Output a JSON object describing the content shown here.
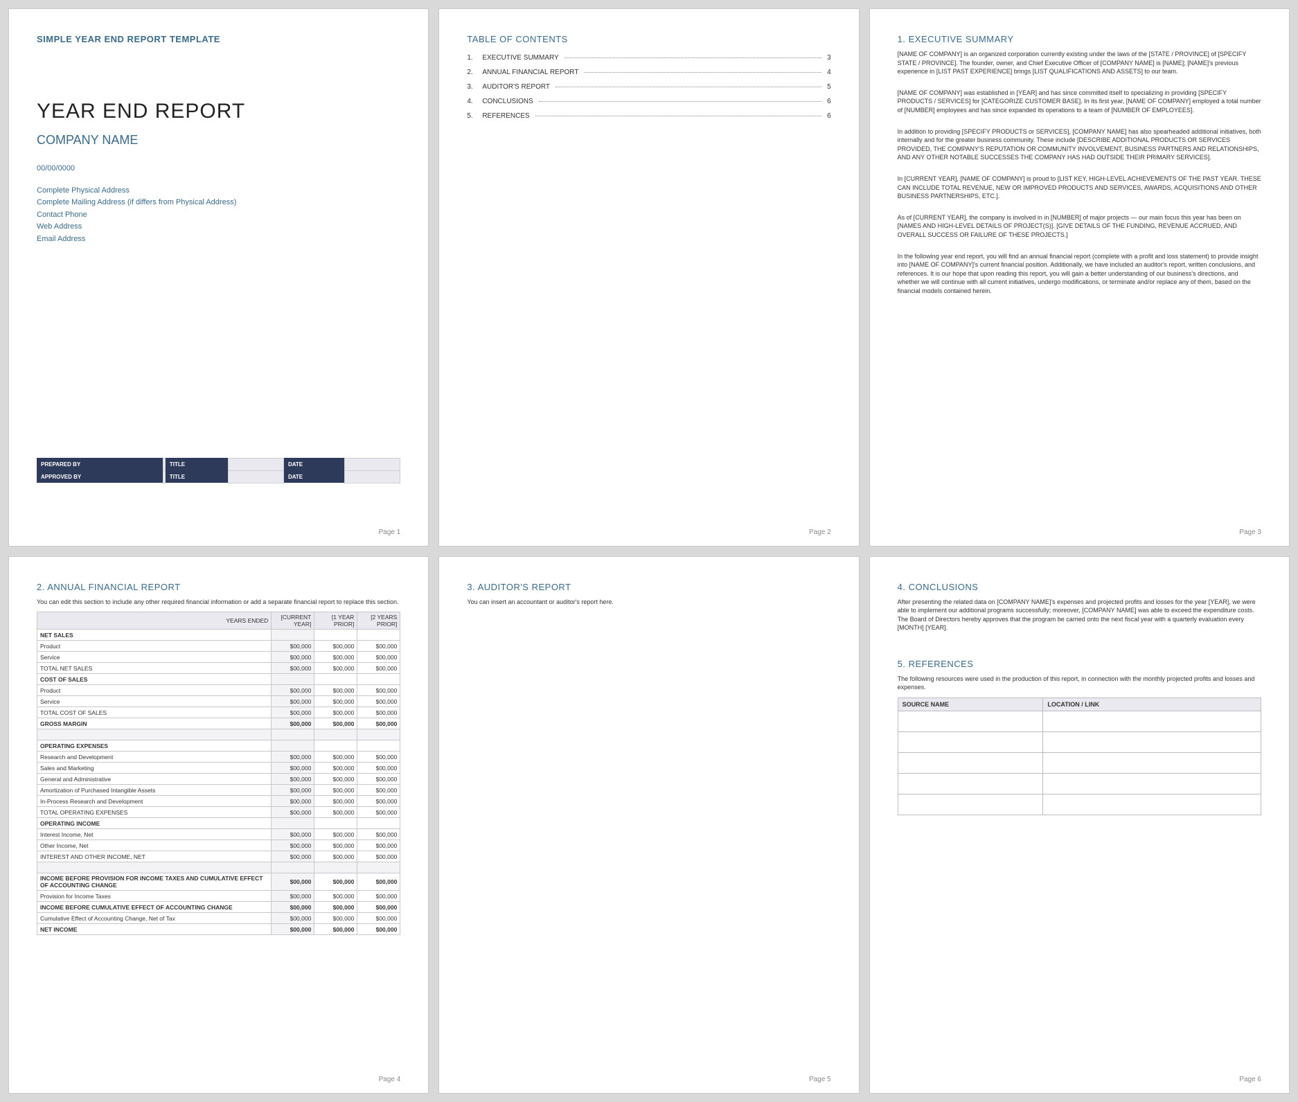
{
  "pageLabels": {
    "p1": "Page 1",
    "p2": "Page 2",
    "p3": "Page 3",
    "p4": "Page 4",
    "p5": "Page 5",
    "p6": "Page 6"
  },
  "cover": {
    "templateLabel": "SIMPLE YEAR END REPORT TEMPLATE",
    "title": "YEAR END REPORT",
    "company": "COMPANY NAME",
    "date": "00/00/0000",
    "fields": [
      "Complete Physical Address",
      "Complete Mailing Address (if differs from Physical Address)",
      "Contact Phone",
      "Web Address",
      "Email Address"
    ],
    "signRows": [
      {
        "l1": "PREPARED BY",
        "l2": "TITLE",
        "l3": "DATE"
      },
      {
        "l1": "APPROVED BY",
        "l2": "TITLE",
        "l3": "DATE"
      }
    ]
  },
  "toc": {
    "heading": "TABLE OF CONTENTS",
    "items": [
      {
        "n": "1.",
        "label": "EXECUTIVE SUMMARY",
        "pg": "3"
      },
      {
        "n": "2.",
        "label": "ANNUAL FINANCIAL REPORT",
        "pg": "4"
      },
      {
        "n": "3.",
        "label": "AUDITOR'S REPORT",
        "pg": "5"
      },
      {
        "n": "4.",
        "label": "CONCLUSIONS",
        "pg": "6"
      },
      {
        "n": "5.",
        "label": "REFERENCES",
        "pg": "6"
      }
    ]
  },
  "exec": {
    "heading": "1. EXECUTIVE SUMMARY",
    "paras": [
      "[NAME OF COMPANY] is an organized corporation currently existing under the laws of the [STATE / PROVINCE] of [SPECIFY STATE / PROVINCE]. The founder, owner, and Chief Executive Officer of [COMPANY NAME] is [NAME]; [NAME]'s previous experience in [LIST PAST EXPERIENCE] brings [LIST QUALIFICATIONS AND ASSETS] to our team.",
      "[NAME OF COMPANY] was established in [YEAR] and has since committed itself to specializing in providing [SPECIFY PRODUCTS / SERVICES] for [CATEGORIZE CUSTOMER BASE]. In its first year, [NAME OF COMPANY] employed a total number of [NUMBER] employees and has since expanded its operations to a team of [NUMBER OF EMPLOYEES].",
      "In addition to providing [SPECIFY PRODUCTS or SERVICES], [COMPANY NAME] has also spearheaded additional initiatives, both internally and for the greater business community. These include [DESCRIBE ADDITIONAL PRODUCTS OR SERVICES PROVIDED, THE COMPANY'S REPUTATION OR COMMUNITY INVOLVEMENT, BUSINESS PARTNERS AND RELATIONSHIPS, AND ANY OTHER NOTABLE SUCCESSES THE COMPANY HAS HAD OUTSIDE THEIR PRIMARY SERVICES].",
      "In [CURRENT YEAR], [NAME OF COMPANY] is proud to [LIST KEY, HIGH-LEVEL ACHIEVEMENTS OF THE PAST YEAR. THESE CAN INCLUDE TOTAL REVENUE, NEW OR IMPROVED PRODUCTS AND SERVICES, AWARDS, ACQUISITIONS AND OTHER BUSINESS PARTNERSHIPS, ETC.].",
      "As of [CURRENT YEAR], the company is involved in in [NUMBER] of major projects — our main focus this year has been on [NAMES AND HIGH-LEVEL DETAILS OF PROJECT(S)]. [GIVE DETAILS OF THE FUNDING, REVENUE ACCRUED, AND OVERALL SUCCESS OR FAILURE OF THESE PROJECTS.]",
      "In the following year end report, you will find an annual financial report (complete with a profit and loss statement) to provide insight into [NAME OF COMPANY]'s current financial position. Additionally, we have included an auditor's report, written conclusions, and references. It is our hope that upon reading this report, you will gain a better understanding of our business's directions, and whether we will continue with all current initiatives, undergo modifications, or terminate and/or replace any of them, based on the financial models contained herein."
    ]
  },
  "fin": {
    "heading": "2. ANNUAL FINANCIAL REPORT",
    "intro": "You can edit this section to include any other required financial information or add a separate financial report to replace this section.",
    "cols": [
      "YEARS ENDED",
      "[CURRENT YEAR]",
      "[1 YEAR PRIOR]",
      "[2 YEARS PRIOR]"
    ],
    "rows": [
      {
        "t": "group",
        "label": "NET SALES"
      },
      {
        "t": "data",
        "label": "Product",
        "v": [
          "$00,000",
          "$00,000",
          "$00,000"
        ]
      },
      {
        "t": "data",
        "label": "Service",
        "v": [
          "$00,000",
          "$00,000",
          "$00,000"
        ]
      },
      {
        "t": "data",
        "label": "TOTAL NET SALES",
        "v": [
          "$00,000",
          "$00,000",
          "$00,000"
        ]
      },
      {
        "t": "group",
        "label": "COST OF SALES"
      },
      {
        "t": "data",
        "label": "Product",
        "v": [
          "$00,000",
          "$00,000",
          "$00,000"
        ]
      },
      {
        "t": "data",
        "label": "Service",
        "v": [
          "$00,000",
          "$00,000",
          "$00,000"
        ]
      },
      {
        "t": "data",
        "label": "TOTAL COST OF SALES",
        "v": [
          "$00,000",
          "$00,000",
          "$00,000"
        ]
      },
      {
        "t": "bold",
        "label": "GROSS MARGIN",
        "v": [
          "$00,000",
          "$00,000",
          "$00,000"
        ]
      },
      {
        "t": "spacer"
      },
      {
        "t": "group",
        "label": "OPERATING EXPENSES"
      },
      {
        "t": "data",
        "label": "Research and Development",
        "v": [
          "$00,000",
          "$00,000",
          "$00,000"
        ]
      },
      {
        "t": "data",
        "label": "Sales and Marketing",
        "v": [
          "$00,000",
          "$00,000",
          "$00,000"
        ]
      },
      {
        "t": "data",
        "label": "General and Administrative",
        "v": [
          "$00,000",
          "$00,000",
          "$00,000"
        ]
      },
      {
        "t": "data",
        "label": "Amortization of Purchased Intangible Assets",
        "v": [
          "$00,000",
          "$00,000",
          "$00,000"
        ]
      },
      {
        "t": "data",
        "label": "In-Process Research and Development",
        "v": [
          "$00,000",
          "$00,000",
          "$00,000"
        ]
      },
      {
        "t": "data",
        "label": "TOTAL OPERATING EXPENSES",
        "v": [
          "$00,000",
          "$00,000",
          "$00,000"
        ]
      },
      {
        "t": "group",
        "label": "OPERATING INCOME"
      },
      {
        "t": "data",
        "label": "Interest Income, Net",
        "v": [
          "$00,000",
          "$00,000",
          "$00,000"
        ]
      },
      {
        "t": "data",
        "label": "Other Income, Net",
        "v": [
          "$00,000",
          "$00,000",
          "$00,000"
        ]
      },
      {
        "t": "data",
        "label": "INTEREST AND OTHER INCOME, NET",
        "v": [
          "$00,000",
          "$00,000",
          "$00,000"
        ]
      },
      {
        "t": "spacer"
      },
      {
        "t": "bold",
        "label": "INCOME BEFORE PROVISION FOR INCOME TAXES AND CUMULATIVE EFFECT OF ACCOUNTING CHANGE",
        "v": [
          "$00,000",
          "$00,000",
          "$00,000"
        ]
      },
      {
        "t": "data",
        "label": "Provision for Income Taxes",
        "v": [
          "$00,000",
          "$00,000",
          "$00,000"
        ]
      },
      {
        "t": "bold",
        "label": "INCOME BEFORE CUMULATIVE EFFECT OF ACCOUNTING CHANGE",
        "v": [
          "$00,000",
          "$00,000",
          "$00,000"
        ]
      },
      {
        "t": "data",
        "label": "Cumulative Effect of Accounting Change, Net of Tax",
        "v": [
          "$00,000",
          "$00,000",
          "$00,000"
        ]
      },
      {
        "t": "bold",
        "label": "NET INCOME",
        "v": [
          "$00,000",
          "$00,000",
          "$00,000"
        ]
      }
    ]
  },
  "auditor": {
    "heading": "3. AUDITOR'S REPORT",
    "intro": "You can insert an accountant or auditor's report here."
  },
  "concl": {
    "heading": "4. CONCLUSIONS",
    "text": "After presenting the related data on [COMPANY NAME]'s expenses and projected profits and losses for the year [YEAR], we were able to implement our additional programs successfully; moreover, [COMPANY NAME] was able to exceed the expenditure costs. The Board of Directors hereby approves that the program be carried onto the next fiscal year with a quarterly evaluation every [MONTH] [YEAR]."
  },
  "refs": {
    "heading": "5. REFERENCES",
    "intro": "The following resources were used in the production of this report, in connection with the monthly projected profits and losses and expenses.",
    "th1": "SOURCE NAME",
    "th2": "LOCATION / LINK"
  }
}
